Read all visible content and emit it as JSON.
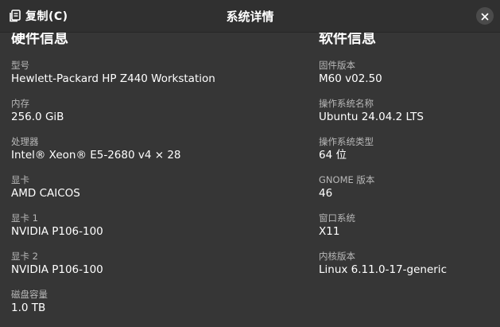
{
  "header": {
    "copy_label": "复制(C)",
    "title": "系统详情",
    "copy_icon": "copy-icon",
    "close_icon": "close-icon"
  },
  "hardware": {
    "title": "硬件信息",
    "items": [
      {
        "label": "型号",
        "value": "Hewlett-Packard HP Z440 Workstation"
      },
      {
        "label": "内存",
        "value": "256.0 GiB"
      },
      {
        "label": "处理器",
        "value": "Intel® Xeon® E5-2680 v4 × 28"
      },
      {
        "label": "显卡",
        "value": "AMD CAICOS"
      },
      {
        "label": "显卡 1",
        "value": "NVIDIA P106-100"
      },
      {
        "label": "显卡 2",
        "value": "NVIDIA P106-100"
      },
      {
        "label": "磁盘容量",
        "value": "1.0 TB"
      }
    ]
  },
  "software": {
    "title": "软件信息",
    "items": [
      {
        "label": "固件版本",
        "value": "M60 v02.50"
      },
      {
        "label": "操作系统名称",
        "value": "Ubuntu 24.04.2 LTS"
      },
      {
        "label": "操作系统类型",
        "value": "64 位"
      },
      {
        "label": "GNOME 版本",
        "value": "46"
      },
      {
        "label": "窗口系统",
        "value": "X11"
      },
      {
        "label": "内核版本",
        "value": "Linux 6.11.0-17-generic"
      }
    ]
  }
}
